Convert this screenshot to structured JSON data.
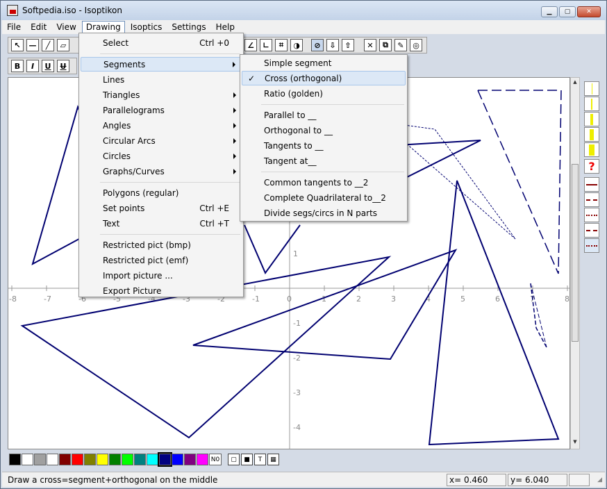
{
  "window": {
    "title": "Softpedia.iso - Isoptikon"
  },
  "menubar": [
    "File",
    "Edit",
    "View",
    "Drawing",
    "Isoptics",
    "Settings",
    "Help"
  ],
  "toolbar_bold": "B",
  "toolbar_italic": "I",
  "toolbar_underline": "U",
  "toolbar_strike": "U",
  "drawing_menu": [
    {
      "label": "Select",
      "shortcut": "Ctrl +0"
    },
    {
      "label": "Segments",
      "submenu": true,
      "highlighted": true
    },
    {
      "label": "Lines"
    },
    {
      "label": "Triangles",
      "submenu": true
    },
    {
      "label": "Parallelograms",
      "submenu": true
    },
    {
      "label": "Angles",
      "submenu": true
    },
    {
      "label": "Circular Arcs",
      "submenu": true
    },
    {
      "label": "Circles",
      "submenu": true
    },
    {
      "label": "Graphs/Curves",
      "submenu": true
    },
    {
      "label": "Polygons (regular)"
    },
    {
      "label": "Set points",
      "shortcut": "Ctrl +E"
    },
    {
      "label": "Text",
      "shortcut": "Ctrl +T"
    },
    {
      "label": "Restricted pict (bmp)"
    },
    {
      "label": "Restricted pict (emf)"
    },
    {
      "label": "Import picture ..."
    },
    {
      "label": "Export Picture"
    }
  ],
  "segments_submenu": [
    {
      "label": "Simple segment"
    },
    {
      "label": "Cross (orthogonal)",
      "checked": true,
      "highlighted": true
    },
    {
      "label": "Ratio (golden)"
    },
    {
      "label": "Parallel to __"
    },
    {
      "label": "Orthogonal to __"
    },
    {
      "label": "Tangents to __"
    },
    {
      "label": "Tangent at__"
    },
    {
      "label": "Common tangents to __2"
    },
    {
      "label": "Complete Quadrilateral to__2"
    },
    {
      "label": "Divide segs/circs in N parts"
    }
  ],
  "axis": {
    "x_ticks": [
      "-8",
      "-7",
      "-6",
      "-5",
      "-4",
      "-3",
      "-2",
      "-1",
      "0",
      "1",
      "2",
      "3",
      "4",
      "5",
      "6",
      "7",
      "8"
    ],
    "y_ticks": [
      "1",
      "-1",
      "-2",
      "-3",
      "-4"
    ]
  },
  "palette": [
    "#000000",
    "#ffffff",
    "#a0a0a0",
    "#ffffff",
    "#800000",
    "#ff0000",
    "#808000",
    "#ffff00",
    "#008000",
    "#00ff00",
    "#008080",
    "#00ffff",
    "#000080",
    "#0000ff",
    "#800080",
    "#ff00ff"
  ],
  "palette_label": "N0",
  "status": {
    "text": "Draw a cross=segment+orthogonal on the middle",
    "x": "x= 0.460",
    "y": "y= 6.040"
  },
  "help_icon": "?"
}
